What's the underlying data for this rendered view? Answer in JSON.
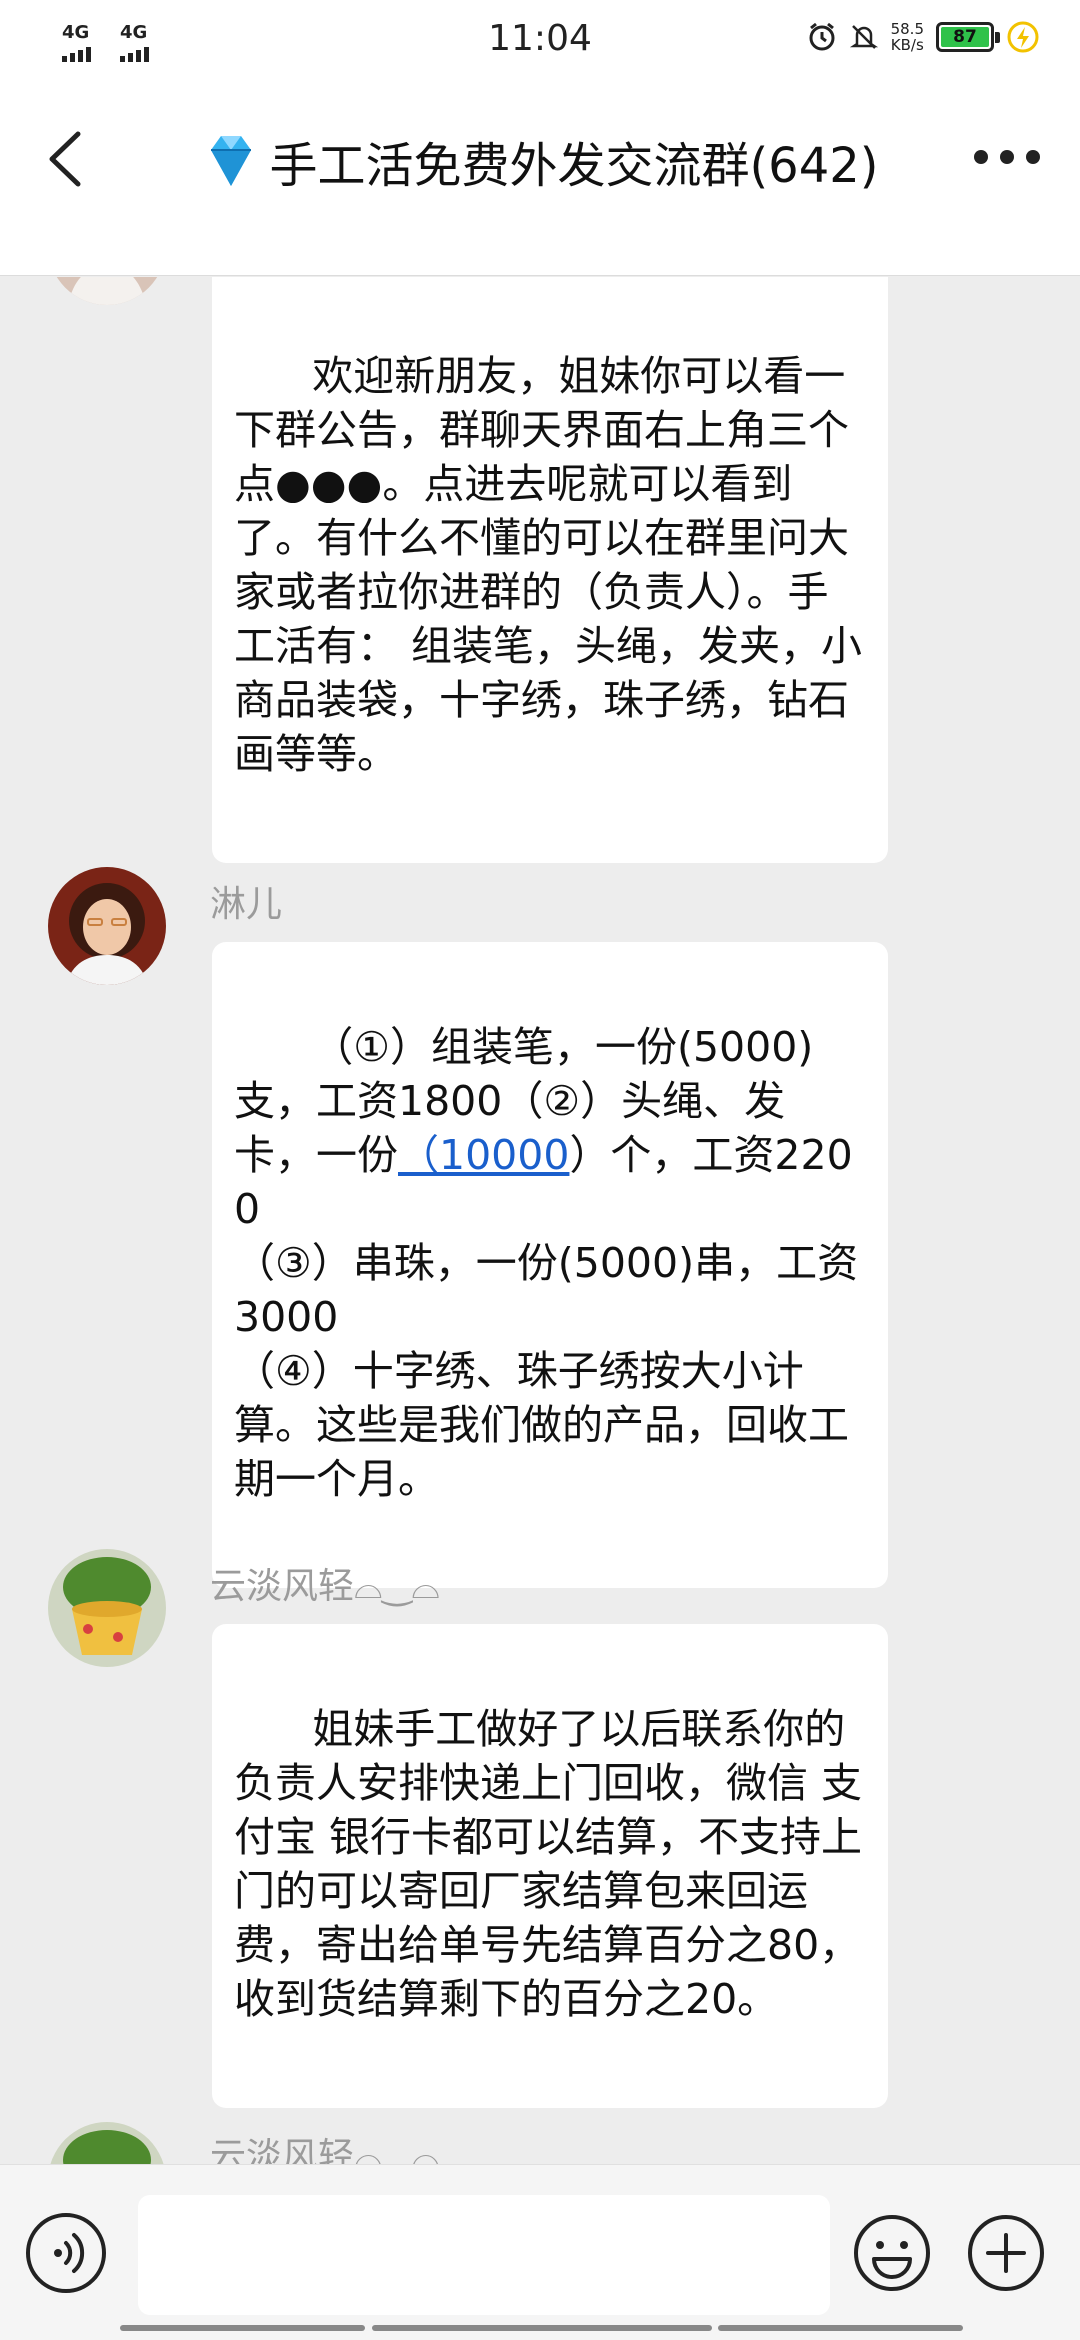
{
  "status_bar": {
    "signal1": "4G",
    "signal2": "4G",
    "time": "11:04",
    "net_speed": "58.5",
    "net_unit": "KB/s",
    "battery": "87"
  },
  "header": {
    "title": "手工活免费外发交流群(642)"
  },
  "messages": [
    {
      "text": "欢迎新朋友，姐妹你可以看一下群公告，群聊天界面右上角三个点●●●。点进去呢就可以看到了。有什么不懂的可以在群里问大家或者拉你进群的（负责人）。手工活有： 组装笔，头绳，发夹，小商品装袋，十字绣，珠子绣，钻石画等等。"
    },
    {
      "sender": "淋儿",
      "part1": "（①）组装笔，一份(5000)支，工资1800（②）头绳、发卡，一份",
      "link": "（10000",
      "part2": "）个，工资2200\n（③）串珠，一份(5000)串，工资3000\n（④）十字绣、珠子绣按大小计算。这些是我们做的产品，回收工期一个月。"
    },
    {
      "sender": "云淡风轻⌓‿⌓",
      "text": "姐妹手工做好了以后联系你的负责人安排快递上门回收，微信 支付宝 银行卡都可以结算，不支持上门的可以寄回厂家结算包来回运费，寄出给单号先结算百分之80，收到货结算剩下的百分之20。"
    },
    {
      "sender": "云淡风轻⌓‿⌓"
    }
  ],
  "colors": {
    "link": "#1a5fcc",
    "battery": "#2fc24a",
    "background": "#ededed"
  }
}
